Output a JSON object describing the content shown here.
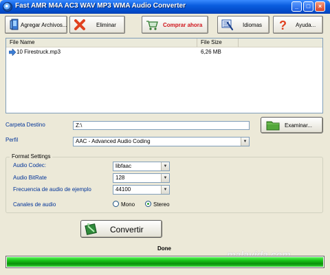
{
  "window": {
    "title": "Fast AMR M4A AC3 WAV MP3 WMA Audio Converter",
    "buttons": {
      "minimize": "_",
      "maximize": "□",
      "close": "×"
    }
  },
  "toolbar": {
    "add_files": "Agregar Archivos...",
    "delete": "Eliminar",
    "buy_now": "Comprar ahora",
    "languages": "Idiomas",
    "help": "Ayuda...",
    "buy_color": "#d0121a"
  },
  "file_list": {
    "columns": [
      "File Name",
      "File Size"
    ],
    "rows": [
      {
        "name": "10 Firestruck.mp3",
        "size": "6,26 MB"
      }
    ]
  },
  "output": {
    "folder_label": "Carpeta Destino",
    "folder_value": "Z:\\",
    "browse_button": "Examinar...",
    "profile_label": "Perfil",
    "profile_value": "AAC - Advanced Audio Coding"
  },
  "format_settings": {
    "title": "Format Settings",
    "codec_label": "Audio Codec:",
    "codec_value": "libfaac",
    "bitrate_label": "Audio BitRate",
    "bitrate_value": "128",
    "samplerate_label": "Frecuencia de audio de ejemplo",
    "samplerate_value": "44100",
    "channels_label": "Canales de audio",
    "channels_options": [
      "Mono",
      "Stereo"
    ],
    "channels_selected": "Stereo"
  },
  "convert_button": "Convertir",
  "status": {
    "text": "Done",
    "progress_percent": 100
  },
  "watermark": "malavida.com"
}
